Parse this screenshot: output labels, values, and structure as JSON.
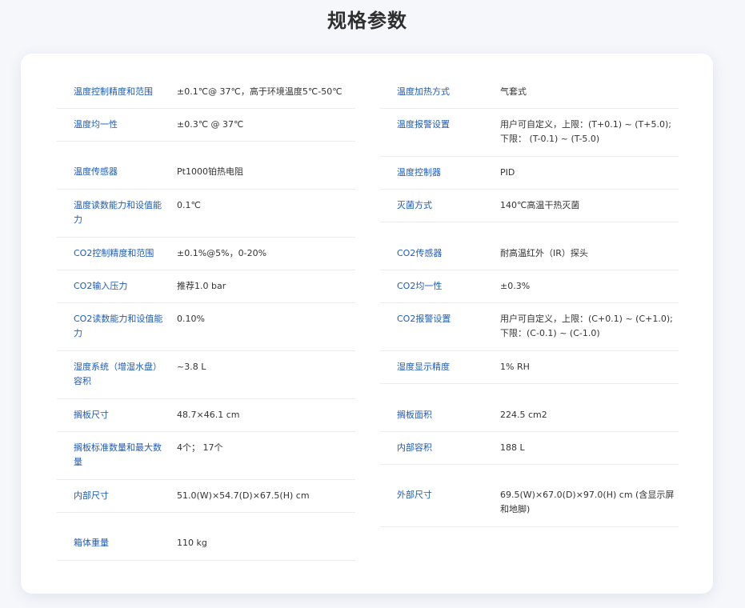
{
  "page": {
    "title": "规格参数"
  },
  "specs_left": [
    {
      "label": "温度控制精度和范围",
      "value": "±0.1℃@ 37℃，高于环境温度5℃-50℃"
    },
    {
      "label": "温度均一性",
      "value": "±0.3℃ @ 37℃"
    },
    {
      "label": "温度传感器",
      "value": "Pt1000铂热电阻"
    },
    {
      "label": "温度读数能力和设值能力",
      "value": "0.1℃"
    },
    {
      "label": "CO2控制精度和范围",
      "value": "±0.1%@5%，0-20%"
    },
    {
      "label": "CO2输入压力",
      "value": "推荐1.0 bar"
    },
    {
      "label": "CO2读数能力和设值能力",
      "value": "0.10%"
    },
    {
      "label": "湿度系统（增湿水盘）容积",
      "value": "~3.8 L"
    },
    {
      "label": "搁板尺寸",
      "value": "48.7×46.1 cm"
    },
    {
      "label": "搁板标准数量和最大数量",
      "value": "4个； 17个"
    },
    {
      "label": "内部尺寸",
      "value": "51.0(W)×54.7(D)×67.5(H) cm"
    },
    {
      "label": "箱体重量",
      "value": "110 kg"
    }
  ],
  "specs_right": [
    {
      "label": "温度加热方式",
      "value": "气套式"
    },
    {
      "label": "温度报警设置",
      "value": "用户可自定义，上限：(T+0.1) ~ (T+5.0);下限： (T-0.1) ~ (T-5.0)"
    },
    {
      "label": "温度控制器",
      "value": "PID"
    },
    {
      "label": "灭菌方式",
      "value": "140℃高温干热灭菌"
    },
    {
      "label": "CO2传感器",
      "value": "耐高温红外（IR）探头"
    },
    {
      "label": "CO2均一性",
      "value": "±0.3%"
    },
    {
      "label": "CO2报警设置",
      "value": "用户可自定义，上限：(C+0.1) ~ (C+1.0); 下限：(C-0.1) ~ (C-1.0)"
    },
    {
      "label": "湿度显示精度",
      "value": "1% RH"
    },
    {
      "label": "搁板面积",
      "value": "224.5 cm2"
    },
    {
      "label": "内部容积",
      "value": "188 L"
    },
    {
      "label": "外部尺寸",
      "value": "69.5(W)×67.0(D)×97.0(H) cm (含显示屏和地脚)"
    }
  ]
}
